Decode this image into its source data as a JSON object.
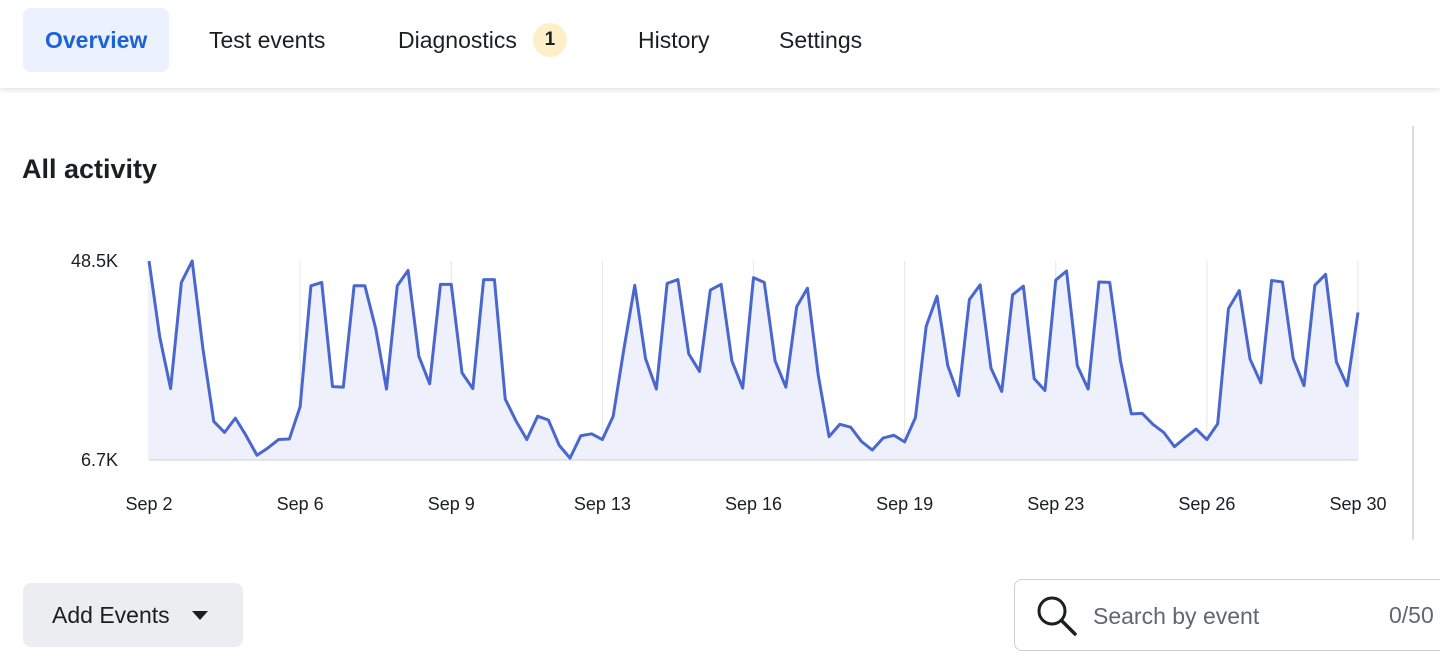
{
  "tabs": [
    {
      "label": "Overview",
      "active": true
    },
    {
      "label": "Test events",
      "active": false
    },
    {
      "label": "Diagnostics",
      "active": false,
      "badge": "1"
    },
    {
      "label": "History",
      "active": false
    },
    {
      "label": "Settings",
      "active": false
    }
  ],
  "section": {
    "title": "All activity"
  },
  "chart_data": {
    "type": "area",
    "title": "All activity",
    "xlabel": "",
    "ylabel": "",
    "y_tick_labels": [
      "48.5K",
      "6.7K"
    ],
    "ylim": [
      6700,
      48500
    ],
    "x_tick_labels": [
      "Sep 2",
      "Sep 6",
      "Sep 9",
      "Sep 13",
      "Sep 16",
      "Sep 19",
      "Sep 23",
      "Sep 26",
      "Sep 30"
    ],
    "grid": true,
    "legend": "none",
    "line_color": "#4a67cf",
    "fill_color": "#eef0fb",
    "series": [
      {
        "values": [
          48500,
          32500,
          21700,
          44000,
          48500,
          30000,
          14800,
          12500,
          15500,
          11800,
          7700,
          9200,
          11000,
          11100,
          17900,
          43300,
          44000,
          22100,
          22000,
          43300,
          43300,
          34300,
          21600,
          43300,
          46500,
          28500,
          22700,
          43600,
          43600,
          25000,
          21700,
          44600,
          44600,
          19500,
          14900,
          11000,
          15900,
          15100,
          9800,
          7100,
          11800,
          12200,
          11000,
          15900,
          30100,
          43400,
          28000,
          21600,
          43800,
          44600,
          29000,
          25300,
          42400,
          43600,
          27500,
          21800,
          45000,
          44000,
          27500,
          22000,
          38900,
          42800,
          24500,
          11600,
          14200,
          13600,
          10600,
          8800,
          11300,
          11900,
          10500,
          15600,
          34800,
          41100,
          26500,
          20200,
          40400,
          43500,
          26000,
          21100,
          41400,
          43200,
          23800,
          21300,
          44500,
          46400,
          26500,
          21600,
          44100,
          44000,
          27500,
          16400,
          16500,
          14200,
          12500,
          9500,
          11400,
          13200,
          11000,
          14300,
          38500,
          42300,
          27900,
          22900,
          44400,
          44100,
          28000,
          22300,
          43400,
          45700,
          27300,
          22300,
          37700
        ]
      }
    ]
  },
  "actions": {
    "add_events_label": "Add Events"
  },
  "search": {
    "placeholder": "Search by event",
    "value": "",
    "count": "0/50"
  }
}
